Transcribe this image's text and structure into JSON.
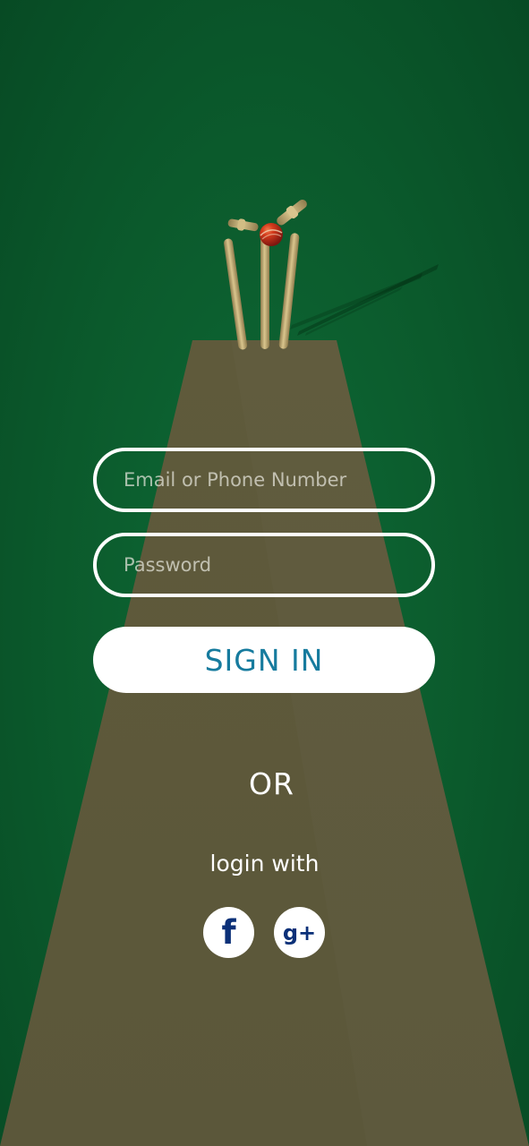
{
  "login_form": {
    "email_placeholder": "Email or Phone Number",
    "password_placeholder": "Password",
    "sign_in_label": "SIGN IN",
    "or_label": "OR",
    "login_with_label": "login with"
  },
  "social_login": {
    "facebook_glyph": "f",
    "google_glyph": "g+",
    "facebook_icon": "facebook-icon",
    "google_icon": "google-plus-icon"
  },
  "colors": {
    "background": "#0d5a2e",
    "pitch": "#5c593a",
    "primary_text": "#ffffff",
    "sign_in_text": "#167b9e",
    "social_icon": "#0b3078"
  }
}
